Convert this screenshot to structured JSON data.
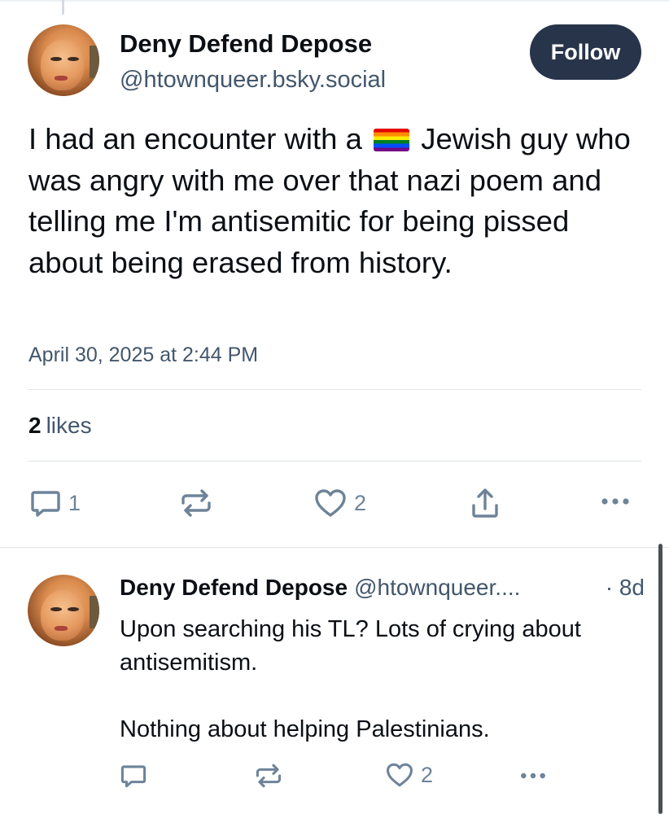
{
  "post": {
    "author_name": "Deny Defend Depose",
    "author_handle": "@htownqueer.bsky.social",
    "follow_label": "Follow",
    "text_before_flag": "I had an encounter with a ",
    "text_after_flag": " Jewish guy who was angry with me over that nazi poem and telling me I'm antisemitic for being pissed about being erased from history.",
    "flag_icon": "rainbow-flag-icon",
    "timestamp": "April 30, 2025 at 2:44 PM",
    "likes_count": "2",
    "likes_label": "likes",
    "actions": {
      "reply_count": "1",
      "repost_count": "",
      "like_count": "2"
    }
  },
  "reply": {
    "author_name": "Deny Defend Depose",
    "author_handle": "@htownqueer....",
    "time": "· 8d",
    "text_line1": "Upon searching his TL? Lots of crying about antisemitism.",
    "text_line2": "Nothing about helping Palestinians.",
    "actions": {
      "reply_count": "",
      "repost_count": "",
      "like_count": "2"
    }
  },
  "colors": {
    "follow_button": "#27344a",
    "muted_text": "#42576c",
    "icon": "#6d8399"
  },
  "icons": [
    "reply-icon",
    "repost-icon",
    "heart-icon",
    "share-icon",
    "more-icon"
  ]
}
